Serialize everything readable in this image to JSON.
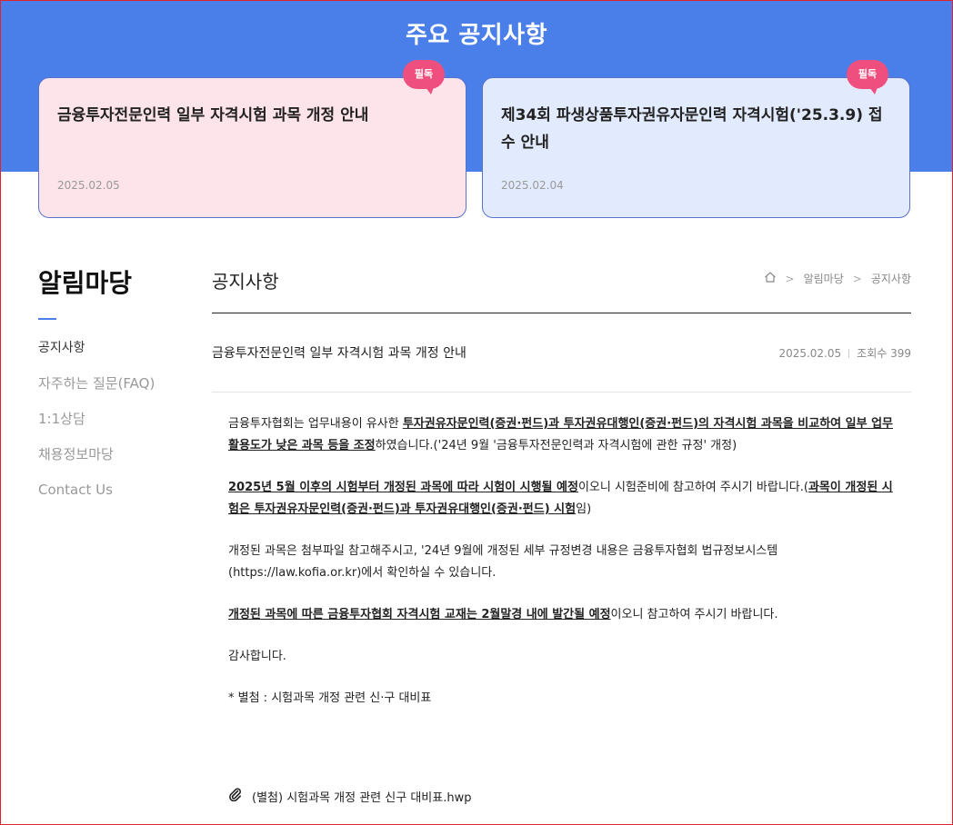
{
  "hero": {
    "title": "주요 공지사항",
    "cards": [
      {
        "title": "금융투자전문인력 일부 자격시험 과목 개정 안내",
        "date": "2025.02.05",
        "badge": "필독",
        "bg": "#fde3ea"
      },
      {
        "title": "제34회 파생상품투자권유자문인력 자격시험('25.3.9) 접수 안내",
        "date": "2025.02.04",
        "badge": "필독",
        "bg": "#e2ebfd"
      }
    ],
    "bg": "#4a7ee8"
  },
  "sidebar": {
    "title": "알림마당",
    "items": [
      {
        "label": "공지사항"
      },
      {
        "label": "자주하는 질문(FAQ)"
      },
      {
        "label": "1:1상담"
      },
      {
        "label": "채용정보마당"
      },
      {
        "label": "Contact Us"
      }
    ]
  },
  "main": {
    "title": "공지사항",
    "breadcrumb": [
      "알림마당",
      "공지사항"
    ],
    "post": {
      "title": "금융투자전문인력 일부 자격시험 과목 개정 안내",
      "date": "2025.02.05",
      "views": "조회수 399",
      "body": {
        "p1_a": "금융투자협회는 업무내용이 유사한 ",
        "p1_b": "투자권유자문인력(증권·펀드)과 투자권유대행인(증권·펀드)의 자격시험 과목을 비교하여 일부 업무 활용도가 낮은 과목 등을 조정",
        "p1_c": "하였습니다.('24년 9월 '금융투자전문인력과 자격시험에 관한 규정' 개정)",
        "p2_a": "2025년 5월 이후의 시험부터 개정된 과목에 따라 시험이 시행될 예정",
        "p2_b": "이오니 시험준비에 참고하여 주시기 바랍니다.(",
        "p2_c": "과목이 개정된 시험은 투자권유자문인력(증권·펀드)과 투자권유대행인(증권·펀드) 시험",
        "p2_d": "임)",
        "p3": "개정된 과목은 첨부파일 참고해주시고, '24년 9월에 개정된 세부 규정변경 내용은 금융투자협회 법규정보시스템(https://law.kofia.or.kr)에서 확인하실 수 있습니다.",
        "p4_a": "개정된 과목에 따른 금융투자협회 자격시험 교재는 2월말경 내에 발간될 예정",
        "p4_b": "이오니 참고하여 주시기 바랍니다.",
        "p5": "감사합니다.",
        "p6": "* 별첨 : 시험과목 개정 관련 신·구 대비표"
      },
      "attachment": "(별첨) 시험과목 개정 관련 신구 대비표.hwp"
    }
  },
  "icons": {
    "home": "home-icon",
    "attach": "paperclip-icon",
    "chevron": "chevron-right-icon"
  }
}
